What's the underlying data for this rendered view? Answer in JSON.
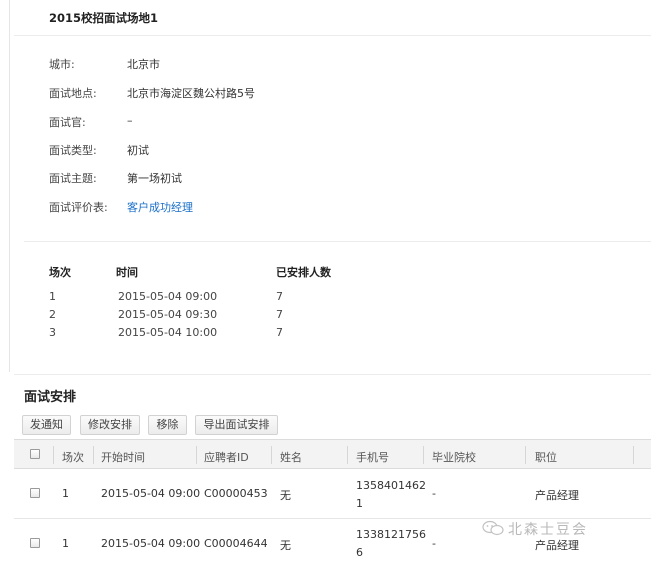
{
  "venue": {
    "title": "2015校招面试场地1",
    "fields": [
      {
        "label": "城市:",
        "value": "北京市"
      },
      {
        "label": "面试地点:",
        "value": "北京市海淀区魏公村路5号"
      },
      {
        "label": "面试官:",
        "value": "–"
      },
      {
        "label": "面试类型:",
        "value": "初试"
      },
      {
        "label": "面试主题:",
        "value": "第一场初试"
      },
      {
        "label": "面试评价表:",
        "value": "客户成功经理"
      }
    ]
  },
  "sessions": {
    "headers": [
      "场次",
      "时间",
      "已安排人数"
    ],
    "rows": [
      {
        "no": "1",
        "time": "2015-05-04 09:00",
        "count": "7"
      },
      {
        "no": "2",
        "time": "2015-05-04 09:30",
        "count": "7"
      },
      {
        "no": "3",
        "time": "2015-05-04 10:00",
        "count": "7"
      }
    ]
  },
  "arrangement": {
    "title": "面试安排",
    "buttons": [
      "发通知",
      "修改安排",
      "移除",
      "导出面试安排"
    ],
    "columns": [
      "场次",
      "开始时间",
      "应聘者ID",
      "姓名",
      "手机号",
      "毕业院校",
      "职位"
    ],
    "rows": [
      {
        "no": "1",
        "start": "2015-05-04 09:00",
        "id": "C00000453",
        "name": "无",
        "phone_line1": "1358401462",
        "phone_line2": "1",
        "school": "-",
        "position": "产品经理"
      },
      {
        "no": "1",
        "start": "2015-05-04 09:00",
        "id": "C00004644",
        "name": "无",
        "phone_line1": "1338121756",
        "phone_line2": "6",
        "school": "-",
        "position": "产品经理"
      }
    ]
  },
  "watermark": {
    "text": "北森士豆会",
    "icon": "wechat-icon"
  },
  "colors": {
    "link": "#1a6fc9",
    "watermark": "#b9b9b9"
  }
}
